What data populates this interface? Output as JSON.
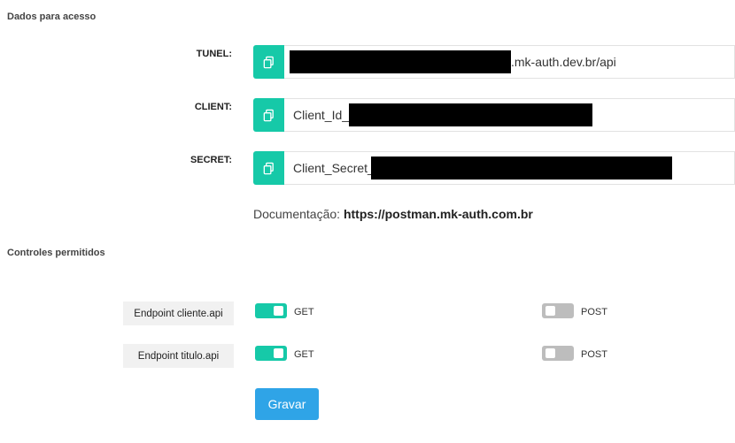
{
  "sections": {
    "access_title": "Dados para acesso",
    "controls_title": "Controles permitidos"
  },
  "fields": [
    {
      "label": "TUNEL:",
      "prefix": "",
      "suffix": ".mk-auth.dev.br/api"
    },
    {
      "label": "CLIENT:",
      "prefix": "Client_Id_",
      "suffix": ""
    },
    {
      "label": "SECRET:",
      "prefix": "Client_Secret_",
      "suffix": ""
    }
  ],
  "documentation": {
    "label": "Documentação:",
    "url": "https://postman.mk-auth.com.br"
  },
  "endpoints": [
    {
      "label": "Endpoint cliente.api",
      "get_label": "GET",
      "get_enabled": true,
      "post_label": "POST",
      "post_enabled": false
    },
    {
      "label": "Endpoint titulo.api",
      "get_label": "GET",
      "get_enabled": true,
      "post_label": "POST",
      "post_enabled": false
    }
  ],
  "actions": {
    "save_label": "Gravar"
  },
  "colors": {
    "accent": "#16c9a8",
    "button": "#2fa4e7",
    "toggle_off": "#bdbdbd"
  },
  "icons": {
    "copy": "copy-icon"
  }
}
